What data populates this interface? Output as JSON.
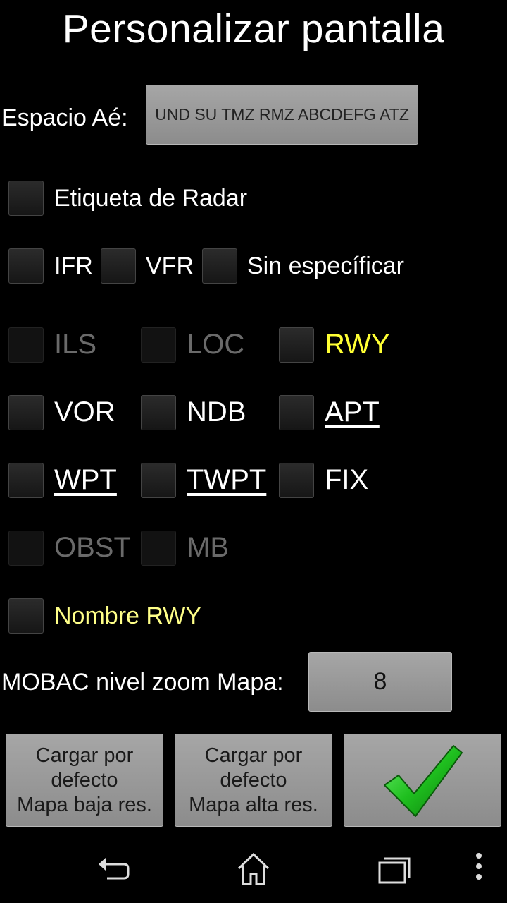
{
  "title": "Personalizar pantalla",
  "airspace": {
    "label": "Espacio Aé:",
    "value": "UND SU TMZ RMZ ABCDEFG ATZ"
  },
  "options": {
    "radar_label": "Etiqueta de Radar",
    "ifr": "IFR",
    "vfr": "VFR",
    "unspecified": "Sin específicar",
    "ils": "ILS",
    "loc": "LOC",
    "rwy": "RWY",
    "vor": "VOR",
    "ndb": "NDB",
    "apt": "APT",
    "wpt": "WPT",
    "twpt": "TWPT",
    "fix": "FIX",
    "obst": "OBST",
    "mb": "MB",
    "rwy_name": "Nombre RWY"
  },
  "zoom": {
    "label": "MOBAC nivel zoom Mapa:",
    "value": "8"
  },
  "buttons": {
    "load_low": "Cargar por\ndefecto\nMapa baja res.",
    "load_high": "Cargar por\ndefecto\nMapa alta res."
  },
  "colors": {
    "accent_yellow": "#ffff33",
    "confirm_green": "#1fbf1f"
  },
  "icons": {
    "confirm": "checkmark-icon",
    "back": "back-icon",
    "home": "home-icon",
    "recents": "recents-icon",
    "menu": "overflow-menu-icon"
  }
}
